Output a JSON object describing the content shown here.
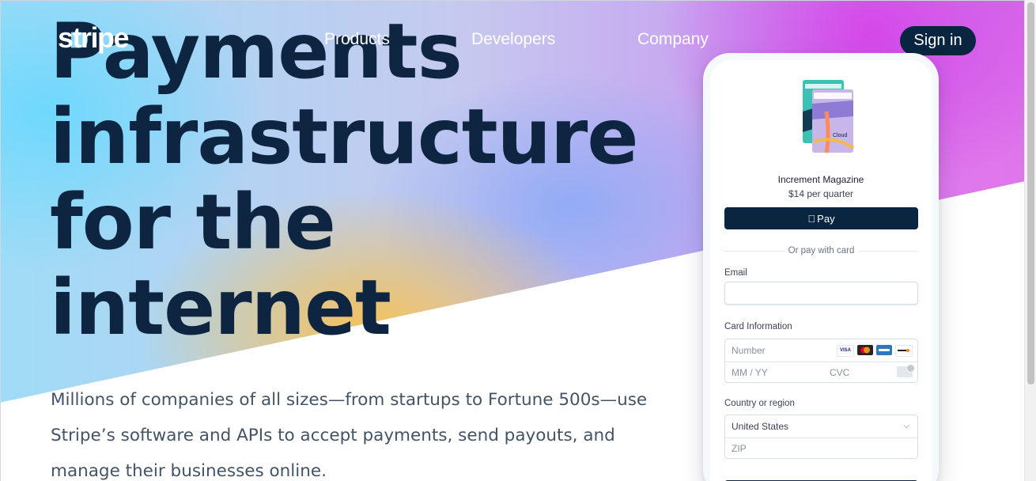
{
  "nav": {
    "logo": "stripe",
    "links": [
      "Products",
      "Developers",
      "Company"
    ],
    "signin": "Sign in"
  },
  "hero": {
    "headline": [
      "Payments",
      "infrastructure",
      "for the",
      "internet"
    ],
    "subtext": "Millions of companies of all sizes—from startups to Fortune 500s—use Stripe’s software and APIs to accept payments, send payouts, and manage their businesses online."
  },
  "checkout": {
    "product_title": "Increment Magazine",
    "price": "$14 per quarter",
    "apple_pay": "Pay",
    "divider": "Or pay with card",
    "email_label": "Email",
    "email_value": "",
    "card_label": "Card Information",
    "card_number_placeholder": "Number",
    "expiry_placeholder": "MM / YY",
    "cvc_placeholder": "CVC",
    "card_brands": [
      "VISA",
      "mastercard",
      "amex",
      "discover"
    ],
    "country_label": "Country or region",
    "country_value": "United States",
    "zip_placeholder": "ZIP"
  },
  "colors": {
    "navy": "#0a2540",
    "headline": "#0d2540",
    "body_text": "#425466",
    "gradient": [
      "#6cd8fd",
      "#8caaf6",
      "#f7c14e",
      "#d643e9"
    ]
  }
}
